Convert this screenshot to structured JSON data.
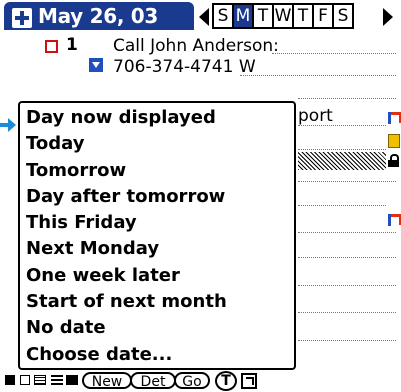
{
  "header": {
    "title": "May 26, 03",
    "weekdays": [
      "S",
      "M",
      "T",
      "W",
      "T",
      "F",
      "S"
    ],
    "selected_weekday_index": 1
  },
  "tasks": [
    {
      "number": "1",
      "text": "Call John Anderson:",
      "phone": "706-374-4741 W"
    },
    {
      "text": "port"
    }
  ],
  "popup": {
    "items": [
      "Day now displayed",
      "Today",
      "Tomorrow",
      "Day after tomorrow",
      "This Friday",
      "Next Monday",
      "One week later",
      "Start of next month",
      "No date",
      "Choose date..."
    ]
  },
  "toolbar": {
    "new_label": "New",
    "details_label": "Det",
    "go_label": "Go",
    "t_label": "T"
  },
  "colors": {
    "accent": "#1a3a8f",
    "checkbox": "#d01010",
    "pointer": "#1a8cd8"
  }
}
